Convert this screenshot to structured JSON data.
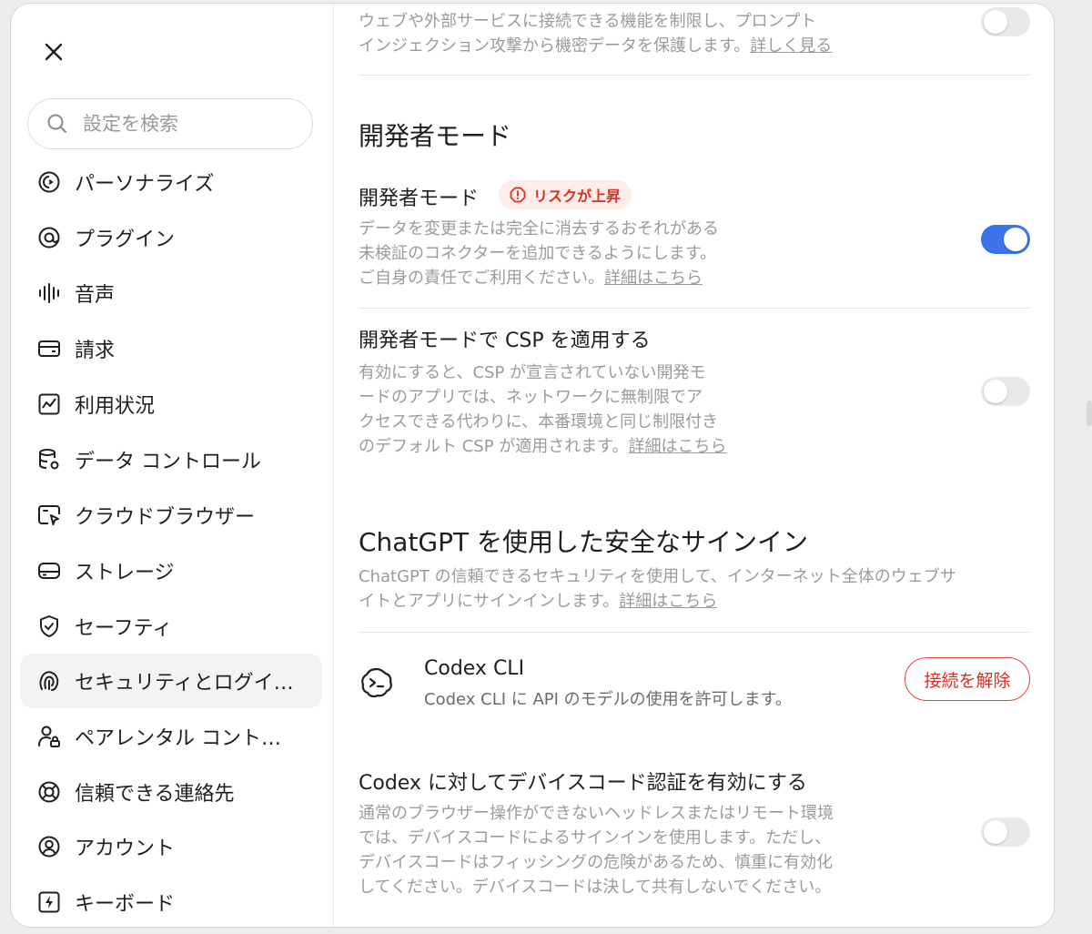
{
  "sidebar": {
    "search_placeholder": "設定を検索",
    "items": [
      {
        "label": "パーソナライズ",
        "icon": "personalize-icon"
      },
      {
        "label": "プラグイン",
        "icon": "plugin-icon"
      },
      {
        "label": "音声",
        "icon": "voice-icon"
      },
      {
        "label": "請求",
        "icon": "billing-icon"
      },
      {
        "label": "利用状況",
        "icon": "usage-icon"
      },
      {
        "label": "データ コントロール",
        "icon": "data-controls-icon"
      },
      {
        "label": "クラウドブラウザー",
        "icon": "cloud-browser-icon"
      },
      {
        "label": "ストレージ",
        "icon": "storage-icon"
      },
      {
        "label": "セーフティ",
        "icon": "safety-icon"
      },
      {
        "label": "セキュリティとログイ…",
        "icon": "security-icon"
      },
      {
        "label": "ペアレンタル コント…",
        "icon": "parental-icon"
      },
      {
        "label": "信頼できる連絡先",
        "icon": "trusted-contacts-icon"
      },
      {
        "label": "アカウント",
        "icon": "account-icon"
      },
      {
        "label": "キーボード",
        "icon": "keyboard-icon"
      }
    ],
    "active_index": 9
  },
  "top_section": {
    "desc_line1": "ウェブや外部サービスに接続できる機能を制限し、プロンプト",
    "desc_line2": "インジェクション攻撃から機密データを保護します。",
    "link": "詳しく見る"
  },
  "dev_mode": {
    "heading": "開発者モード",
    "setting_title": "開発者モード",
    "badge": "リスクが上昇",
    "desc_line1": "データを変更または完全に消去するおそれがある",
    "desc_line2": "未検証のコネクターを追加できるようにします。",
    "desc_line3": "ご自身の責任でご利用ください。",
    "link": "詳細はこちら",
    "enabled": true
  },
  "csp": {
    "title": "開発者モードで CSP を適用する",
    "desc_line1": "有効にすると、CSP が宣言されていない開発モ",
    "desc_line2": "ードのアプリでは、ネットワークに無制限でア",
    "desc_line3": "クセスできる代わりに、本番環境と同じ制限付き",
    "desc_line4": "のデフォルト CSP が適用されます。",
    "link": "詳細はこちら",
    "enabled": false
  },
  "signin": {
    "heading": "ChatGPT を使用した安全なサインイン",
    "desc_line1": "ChatGPT の信頼できるセキュリティを使用して、インターネット全体のウェブサ",
    "desc_line2": "イトとアプリにサインインします。",
    "link": "詳細はこちら",
    "app_name": "Codex CLI",
    "app_desc": "Codex CLI に API のモデルの使用を許可します。",
    "disconnect_label": "接続を解除"
  },
  "device_code": {
    "title": "Codex に対してデバイスコード認証を有効にする",
    "desc_line1": "通常のブラウザー操作ができないヘッドレスまたはリモート環境",
    "desc_line2": "では、デバイスコードによるサインインを使用します。ただし、",
    "desc_line3": "デバイスコードはフィッシングの危険があるため、慎重に有効化",
    "desc_line4": "してください。デバイスコードは決して共有しないでください。",
    "enabled": false
  },
  "colors": {
    "toggle_on": "#3b74e8",
    "danger": "#d93025"
  }
}
